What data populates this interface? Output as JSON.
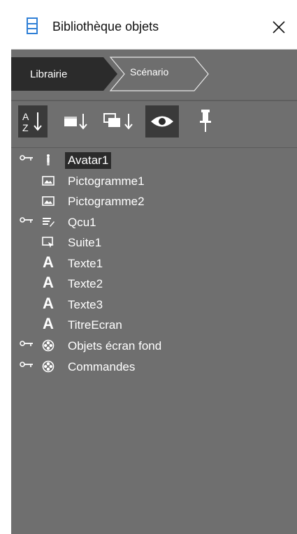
{
  "window": {
    "title": "Bibliothèque objets"
  },
  "tabs": [
    {
      "label": "Librairie",
      "active": true
    },
    {
      "label": "Scénario",
      "active": false
    }
  ],
  "toolbar": {
    "buttons": [
      {
        "icon": "sort-az-icon",
        "active": true
      },
      {
        "icon": "sort-layers-icon",
        "active": false
      },
      {
        "icon": "sort-windows-icon",
        "active": false
      },
      {
        "icon": "eye-icon",
        "active": true
      },
      {
        "icon": "pin-icon",
        "active": false
      }
    ]
  },
  "tree": {
    "items": [
      {
        "label": "Avatar1",
        "icon": "avatar-icon",
        "has_key": true,
        "selected": true
      },
      {
        "label": "Pictogramme1",
        "icon": "picture-icon",
        "has_key": false,
        "selected": false
      },
      {
        "label": "Pictogramme2",
        "icon": "picture-icon",
        "has_key": false,
        "selected": false
      },
      {
        "label": "Qcu1",
        "icon": "quiz-icon",
        "has_key": true,
        "selected": false
      },
      {
        "label": "Suite1",
        "icon": "next-icon",
        "has_key": false,
        "selected": false
      },
      {
        "label": "Texte1",
        "icon": "text-icon",
        "has_key": false,
        "selected": false
      },
      {
        "label": "Texte2",
        "icon": "text-icon",
        "has_key": false,
        "selected": false
      },
      {
        "label": "Texte3",
        "icon": "text-icon",
        "has_key": false,
        "selected": false
      },
      {
        "label": "TitreEcran",
        "icon": "text-icon",
        "has_key": false,
        "selected": false
      },
      {
        "label": "Objets écran fond",
        "icon": "group-icon",
        "has_key": true,
        "selected": false
      },
      {
        "label": "Commandes",
        "icon": "group-icon",
        "has_key": true,
        "selected": false
      }
    ]
  },
  "colors": {
    "panel_bg": "#6f6f6f",
    "active_bg": "#2b2b2b",
    "accent_blue": "#2f7fd6",
    "text": "#ffffff"
  }
}
